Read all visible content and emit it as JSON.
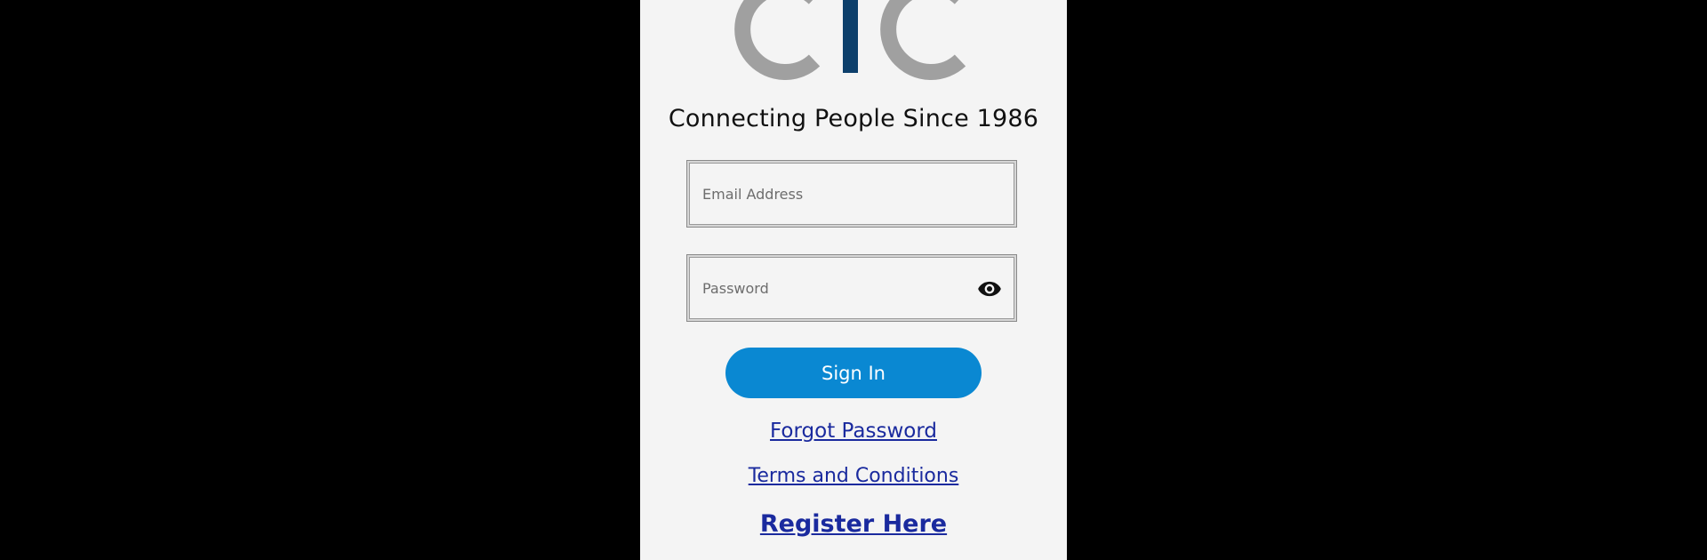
{
  "brand": {
    "logo_text": "CTC",
    "tagline": "Connecting People Since 1986",
    "colors": {
      "logo_gray": "#a0a0a0",
      "logo_blue": "#0d3f6b",
      "accent": "#0a88d2",
      "link": "#1a2a9e",
      "background": "#f4f4f4"
    }
  },
  "form": {
    "email_placeholder": "Email Address",
    "email_value": "",
    "password_placeholder": "Password",
    "password_value": "",
    "reveal_icon": "eye-icon",
    "submit_label": "Sign In"
  },
  "links": {
    "forgot": "Forgot Password",
    "terms": "Terms and Conditions",
    "register": "Register Here"
  }
}
